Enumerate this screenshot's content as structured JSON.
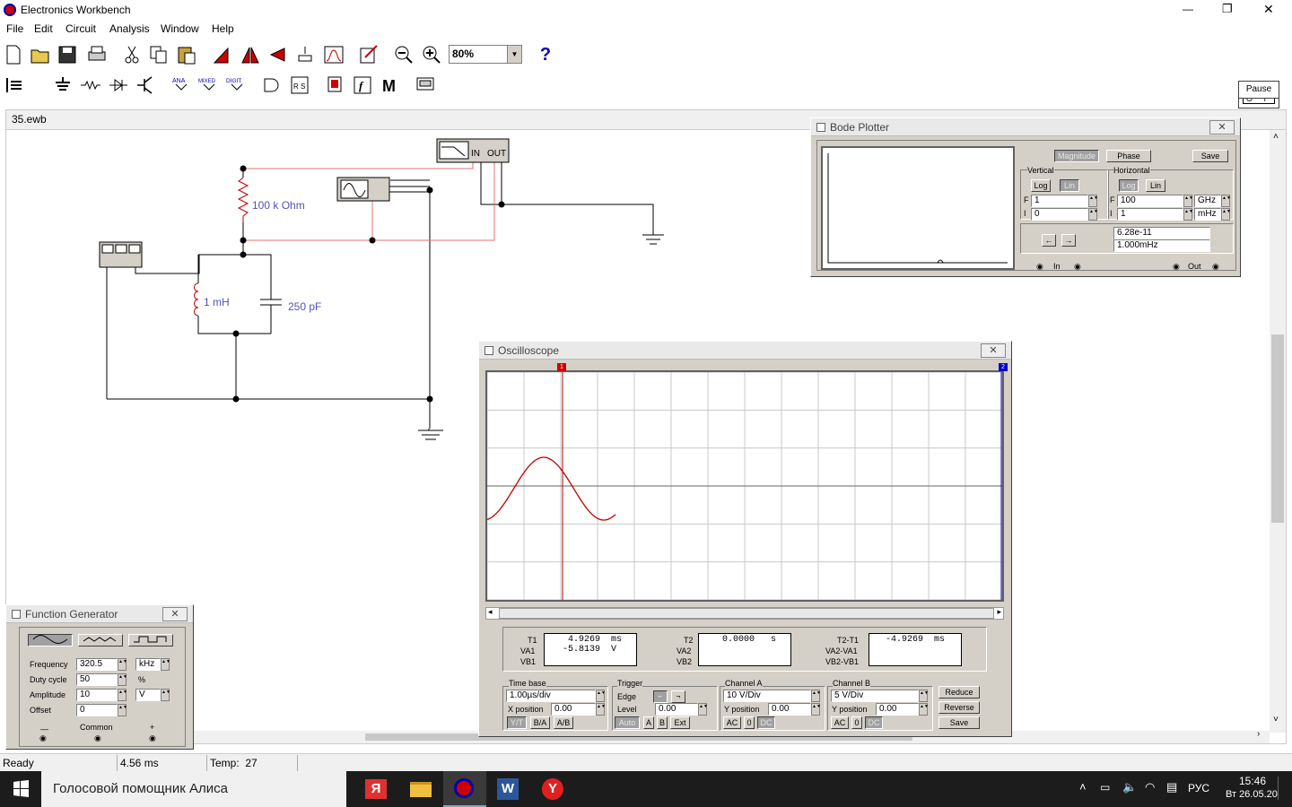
{
  "app": {
    "title": "Electronics Workbench",
    "doc_title": "35.ewb"
  },
  "window_controls": {
    "minimize": "—",
    "restore": "❐",
    "close": "✕"
  },
  "menu": [
    "File",
    "Edit",
    "Circuit",
    "Analysis",
    "Window",
    "Help"
  ],
  "toolbar": {
    "zoom": "80%",
    "help": "?"
  },
  "power": {
    "pause": "Pause"
  },
  "circuit": {
    "resistor": "100 k Ohm",
    "inductor": "1 mH",
    "capacitor": "250 pF",
    "bode_in": "IN",
    "bode_out": "OUT"
  },
  "bode": {
    "title": "Bode Plotter",
    "magnitude": "Magnitude",
    "phase": "Phase",
    "save": "Save",
    "vertical": "Vertical",
    "horizontal": "Horizontal",
    "log": "Log",
    "lin": "Lin",
    "f_label": "F",
    "i_label": "I",
    "v_f": "1",
    "v_i": "0",
    "h_f": "100",
    "h_f_unit": "GHz",
    "h_i": "1",
    "h_i_unit": "mHz",
    "readout1": "6.28e-11",
    "readout2": "1.000mHz",
    "in": "In",
    "out": "Out",
    "left_arrow": "←",
    "right_arrow": "→"
  },
  "scope": {
    "title": "Oscilloscope",
    "t1": "T1",
    "va1": "VA1",
    "vb1": "VB1",
    "t1_val": "4.9269  ms",
    "va1_val": "-5.8139  V",
    "t2": "T2",
    "va2": "VA2",
    "vb2": "VB2",
    "t2_val": "0.0000   s",
    "dt": "T2-T1",
    "dva": "VA2-VA1",
    "dvb": "VB2-VB1",
    "dt_val": "-4.9269  ms",
    "timebase": "Time base",
    "timebase_val": "1.00µs/div",
    "xpos": "X position",
    "xpos_val": "0.00",
    "yt": "Y/T",
    "ba": "B/A",
    "ab": "A/B",
    "trigger": "Trigger",
    "edge": "Edge",
    "level": "Level",
    "level_val": "0.00",
    "auto": "Auto",
    "a": "A",
    "b": "B",
    "ext": "Ext",
    "cha": "Channel A",
    "cha_val": "10  V/Div",
    "ypos": "Y position",
    "cha_ypos": "0.00",
    "chb": "Channel B",
    "chb_val": "5  V/Div",
    "chb_ypos": "0.00",
    "ac": "AC",
    "zero": "0",
    "dc": "DC",
    "reduce": "Reduce",
    "reverse": "Reverse",
    "save": "Save",
    "cursor1": "1",
    "cursor2": "2"
  },
  "fgen": {
    "title": "Function Generator",
    "frequency": "Frequency",
    "freq_val": "320.5",
    "freq_unit": "kHz",
    "duty": "Duty cycle",
    "duty_val": "50",
    "duty_unit": "%",
    "amplitude": "Amplitude",
    "amp_val": "10",
    "amp_unit": "V",
    "offset": "Offset",
    "offset_val": "0",
    "minus": "—",
    "common": "Common",
    "plus": "+"
  },
  "status": {
    "ready": "Ready",
    "time": "4.56 ms",
    "temp": "Temp:  27"
  },
  "taskbar": {
    "search": "Голосовой помощник Алиса",
    "lang": "РУС",
    "time": "15:46",
    "date": "Вт 26.05.20"
  },
  "colors": {
    "trace": "#c00000",
    "wire_red": "#e07070",
    "component": "#c00000"
  }
}
